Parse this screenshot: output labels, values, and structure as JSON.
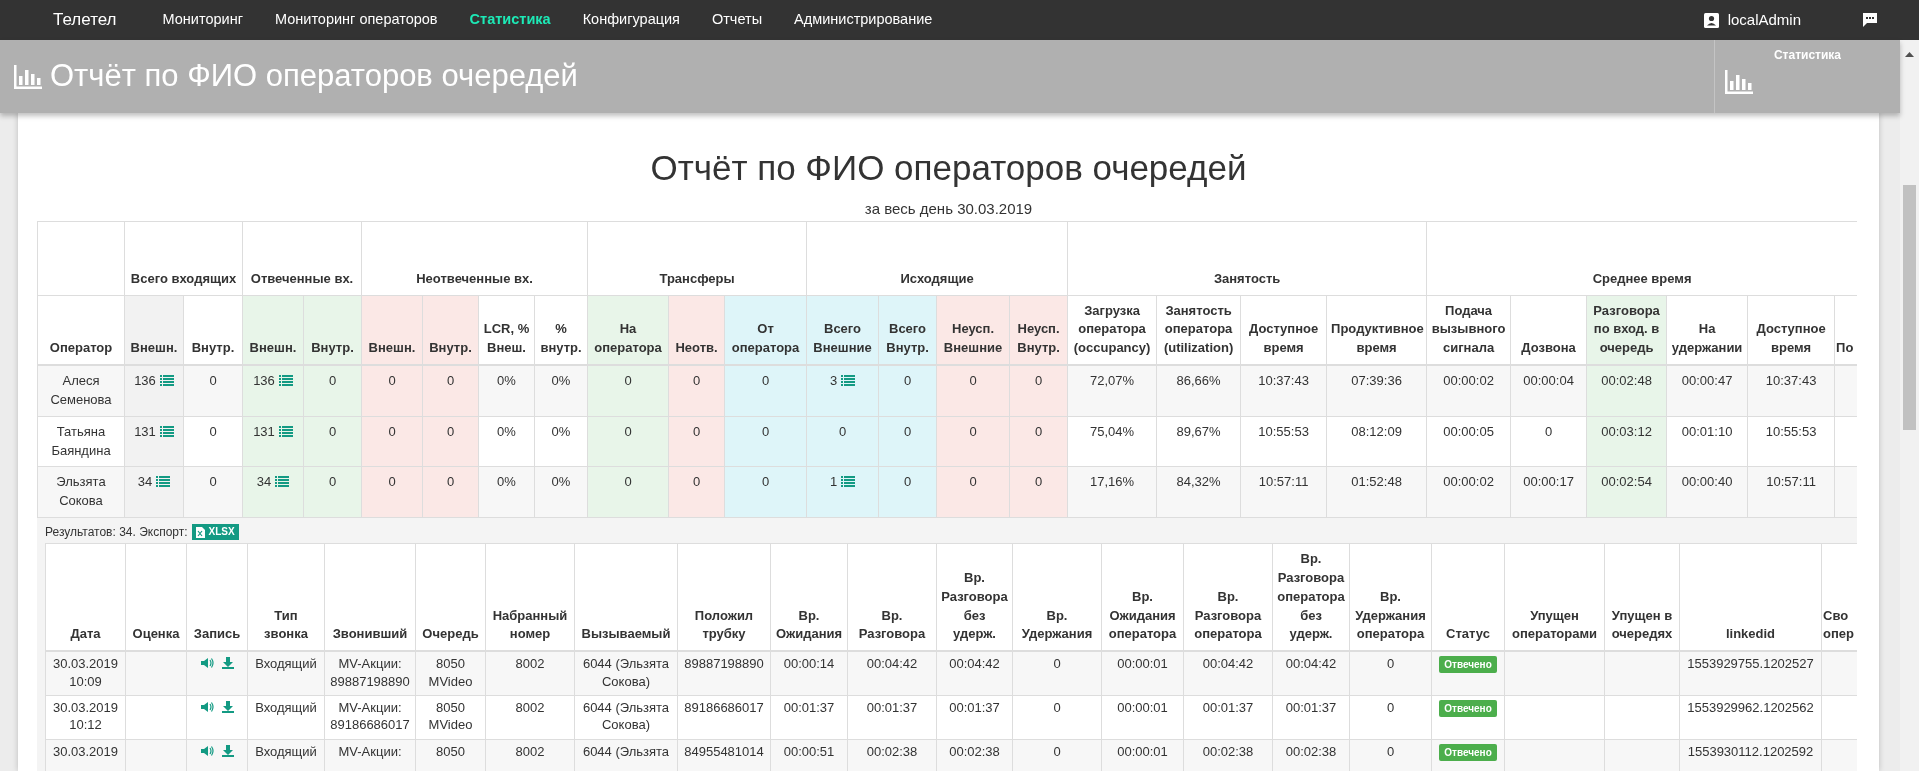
{
  "navbar": {
    "brand": "Телетел",
    "items": [
      {
        "label": "Мониторинг",
        "selected": false
      },
      {
        "label": "Мониторинг операторов",
        "selected": false
      },
      {
        "label": "Статистика",
        "selected": true
      },
      {
        "label": "Конфигурация",
        "selected": false
      },
      {
        "label": "Отчеты",
        "selected": false
      },
      {
        "label": "Администрирование",
        "selected": false
      }
    ],
    "user": "localAdmin"
  },
  "header": {
    "title": "Отчёт по ФИО операторов очередей",
    "side_label": "Статистика"
  },
  "report": {
    "title": "Отчёт по ФИО операторов очередей",
    "subtitle": "за весь день 30.03.2019",
    "summary_table": {
      "groups": [
        {
          "columns": [
            {
              "label": "Оператор"
            }
          ]
        },
        {
          "label": "Всего входящих",
          "columns": [
            {
              "label": "Внешн.",
              "color": "#f2f2f2"
            },
            {
              "label": "Внутр."
            }
          ]
        },
        {
          "label": "Отвеченные вх.",
          "columns": [
            {
              "label": "Внешн.",
              "color": "#e8f5e9"
            },
            {
              "label": "Внутр.",
              "color": "#e8f5e9"
            }
          ]
        },
        {
          "label": "Неотвеченные вх.",
          "columns": [
            {
              "label": "Внешн.",
              "color": "#fbe8e6"
            },
            {
              "label": "Внутр.",
              "color": "#fbe8e6"
            },
            {
              "label": "LCR, % Внеш."
            },
            {
              "label": "% внутр."
            }
          ]
        },
        {
          "label": "Трансферы",
          "columns": [
            {
              "label": "На оператора",
              "color": "#e8f5e9"
            },
            {
              "label": "Неотв.",
              "color": "#fbe8e6"
            },
            {
              "label": "От оператора",
              "color": "#def5f9"
            }
          ]
        },
        {
          "label": "Исходящие",
          "columns": [
            {
              "label": "Всего Внешние",
              "color": "#def5f9"
            },
            {
              "label": "Всего Внутр.",
              "color": "#def5f9"
            },
            {
              "label": "Неусп. Внешние",
              "color": "#fbe8e6"
            },
            {
              "label": "Неусп. Внутр.",
              "color": "#fbe8e6"
            }
          ]
        },
        {
          "label": "Занятость",
          "columns": [
            {
              "label": "Загрузка оператора (occupancy)"
            },
            {
              "label": "Занятость оператора (utilization)"
            },
            {
              "label": "Доступное время"
            },
            {
              "label": "Продуктивное время"
            }
          ]
        },
        {
          "label": "Среднее время",
          "columns": [
            {
              "label": "Подача вызывного сигнала"
            },
            {
              "label": "Дозвона"
            },
            {
              "label": "Разговора по вход. в очередь",
              "color": "#e8f5e9"
            },
            {
              "label": "На удержании"
            },
            {
              "label": "Доступное время"
            },
            {
              "label": "По"
            }
          ]
        }
      ],
      "rows": [
        {
          "cells": [
            "Алеся Семенова",
            {
              "text": "136",
              "details": true
            },
            "0",
            {
              "text": "136",
              "details": true
            },
            "0",
            "0",
            "0",
            "0%",
            "0%",
            "0",
            "0",
            "0",
            {
              "text": "3",
              "details": true
            },
            "0",
            "0",
            "0",
            "72,07%",
            "86,66%",
            "10:37:43",
            "07:39:36",
            "00:00:02",
            "00:00:04",
            "00:02:48",
            "00:00:47",
            "10:37:43"
          ]
        },
        {
          "cells": [
            "Татьяна Баяндина",
            {
              "text": "131",
              "details": true
            },
            "0",
            {
              "text": "131",
              "details": true
            },
            "0",
            "0",
            "0",
            "0%",
            "0%",
            "0",
            "0",
            "0",
            "0",
            "0",
            "0",
            "0",
            "75,04%",
            "89,67%",
            "10:55:53",
            "08:12:09",
            "00:00:05",
            "0",
            "00:03:12",
            "00:01:10",
            "10:55:53"
          ]
        },
        {
          "cells": [
            "Эльзята Сокова",
            {
              "text": "34",
              "details": true
            },
            "0",
            {
              "text": "34",
              "details": true
            },
            "0",
            "0",
            "0",
            "0%",
            "0%",
            "0",
            "0",
            "0",
            {
              "text": "1",
              "details": true
            },
            "0",
            "0",
            "0",
            "17,16%",
            "84,32%",
            "10:57:11",
            "01:52:48",
            "00:00:02",
            "00:00:17",
            "00:02:54",
            "00:00:40",
            "10:57:11"
          ]
        }
      ]
    },
    "results_text": "Результатов: 34. Экспорт:",
    "export_button": "XLSX",
    "calls_table": {
      "columns": [
        {
          "label": "Дата",
          "kind": "text"
        },
        {
          "label": "Оценка",
          "kind": "blank"
        },
        {
          "label": "Запись",
          "kind": "recording"
        },
        {
          "label": "Тип звонка",
          "kind": "text"
        },
        {
          "label": "Звонивший",
          "kind": "text"
        },
        {
          "label": "Очередь",
          "kind": "text"
        },
        {
          "label": "Набранный номер",
          "kind": "text"
        },
        {
          "label": "Вызываемый",
          "kind": "text"
        },
        {
          "label": "Положил трубку",
          "kind": "text"
        },
        {
          "label": "Вр. Ожидания",
          "kind": "text"
        },
        {
          "label": "Вр. Разговора",
          "kind": "text"
        },
        {
          "label": "Вр. Разговора без удерж.",
          "kind": "text"
        },
        {
          "label": "Вр. Удержания",
          "kind": "text"
        },
        {
          "label": "Вр. Ожидания оператора",
          "kind": "text"
        },
        {
          "label": "Вр. Разговора оператора",
          "kind": "text"
        },
        {
          "label": "Вр. Разговора оператора без удерж.",
          "kind": "text"
        },
        {
          "label": "Вр. Удержания оператора",
          "kind": "text"
        },
        {
          "label": "Статус",
          "kind": "status"
        },
        {
          "label": "Упущен операторами",
          "kind": "blank"
        },
        {
          "label": "Упущен в очередях",
          "kind": "blank"
        },
        {
          "label": "linkedid",
          "kind": "text"
        },
        {
          "label": "Сво опер",
          "kind": "blank"
        }
      ],
      "rows": [
        {
          "recording": true,
          "cells": [
            "30.03.2019 10:09",
            "",
            "",
            "Входящий",
            "MV-Акции: 89887198890",
            "8050 MVideo",
            "8002",
            "6044 (Эльзята Сокова)",
            "89887198890",
            "00:00:14",
            "00:04:42",
            "00:04:42",
            "0",
            "00:00:01",
            "00:04:42",
            "00:04:42",
            "0",
            "Отвечено",
            "",
            "",
            "1553929755.1202527"
          ]
        },
        {
          "recording": true,
          "cells": [
            "30.03.2019 10:12",
            "",
            "",
            "Входящий",
            "MV-Акции: 89186686017",
            "8050 MVideo",
            "8002",
            "6044 (Эльзята Сокова)",
            "89186686017",
            "00:01:37",
            "00:01:37",
            "00:01:37",
            "0",
            "00:00:01",
            "00:01:37",
            "00:01:37",
            "0",
            "Отвечено",
            "",
            "",
            "1553929962.1202562"
          ]
        },
        {
          "recording": true,
          "cells": [
            "30.03.2019",
            "",
            "",
            "Входящий",
            "MV-Акции:",
            "8050",
            "8002",
            "6044 (Эльзята",
            "84955481014",
            "00:00:51",
            "00:02:38",
            "00:02:38",
            "0",
            "00:00:01",
            "00:02:38",
            "00:02:38",
            "0",
            "Отвечено",
            "",
            "",
            "1553930112.1202592"
          ]
        }
      ]
    }
  }
}
